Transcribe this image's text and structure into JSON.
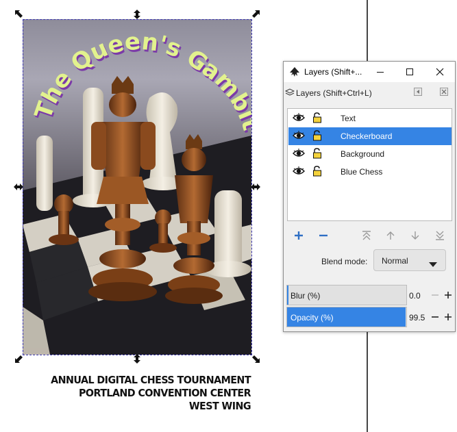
{
  "poster": {
    "title_arc": "The Queen's Gambit",
    "caption_lines": [
      "ANNUAL DIGITAL CHESS TOURNAMENT",
      "PORTLAND CONVENTION CENTER",
      "WEST WING"
    ]
  },
  "layers_window": {
    "window_title": "Layers (Shift+...",
    "dock_title": "Layers (Shift+Ctrl+L)",
    "layers": [
      {
        "name": "Text",
        "visible": true,
        "locked": false,
        "selected": false
      },
      {
        "name": "Checkerboard",
        "visible": true,
        "locked": false,
        "selected": true
      },
      {
        "name": "Background",
        "visible": true,
        "locked": false,
        "selected": false
      },
      {
        "name": "Blue Chess",
        "visible": true,
        "locked": false,
        "selected": false
      }
    ],
    "toolbar_icons": [
      "add-layer-icon",
      "remove-layer-icon",
      "raise-to-top-icon",
      "raise-icon",
      "lower-icon",
      "lower-to-bottom-icon"
    ],
    "blend_mode": {
      "label": "Blend mode:",
      "value": "Normal"
    },
    "blur": {
      "label": "Blur (%)",
      "value": "0.0"
    },
    "opacity": {
      "label": "Opacity (%)",
      "value": "99.5"
    }
  },
  "colors": {
    "selection_blue": "#3584e4",
    "title_text": "#e2f28e",
    "title_shadow": "#7b3aa8"
  }
}
